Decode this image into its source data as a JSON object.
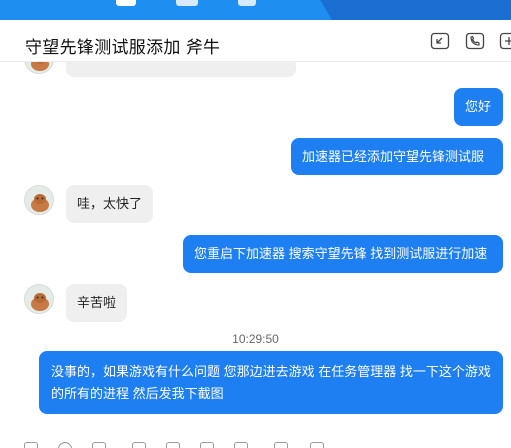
{
  "header": {
    "title": "守望先锋测试服添加 斧牛"
  },
  "messages": [
    {
      "side": "in",
      "text": ""
    },
    {
      "side": "out",
      "text": "您好"
    },
    {
      "side": "out",
      "text": "加速器已经添加守望先锋测试服"
    },
    {
      "side": "in",
      "text": "哇，太快了"
    },
    {
      "side": "out",
      "text": "您重启下加速器  搜索守望先锋 找到测试服进行加速"
    },
    {
      "side": "in",
      "text": "辛苦啦"
    },
    {
      "side": "out",
      "text": "没事的，如果游戏有什么问题  您那边进去游戏 在任务管理器 找一下这个游戏的所有的进程 然后发我下截图"
    }
  ],
  "timestamp": "10:29:50",
  "colors": {
    "accent": "#1e7ff3",
    "incoming_bubble": "#efefef",
    "topbar": "#1f8ef1"
  },
  "icons": {
    "header": [
      "minimize-window-icon",
      "phone-icon",
      "add-icon"
    ],
    "toolbar": [
      "font-icon",
      "emoji-icon",
      "scissors-icon",
      "folder-icon",
      "image-icon",
      "screenshot-icon",
      "more-icon"
    ]
  }
}
